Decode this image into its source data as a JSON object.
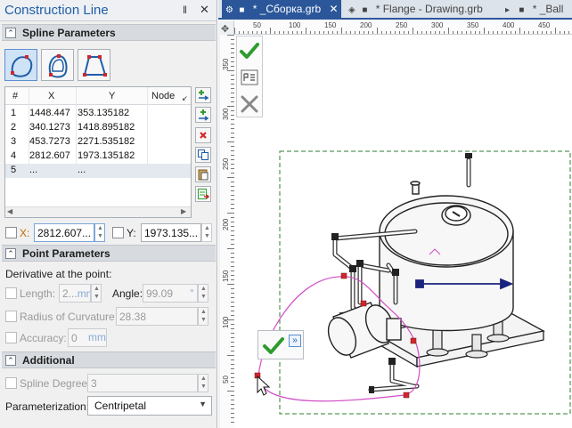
{
  "panel": {
    "title": "Construction Line",
    "pin_glyph": "‖",
    "close_glyph": "✕"
  },
  "sections": {
    "spline": "Spline Parameters",
    "point": "Point Parameters",
    "additional": "Additional"
  },
  "spline_modes": [
    {
      "name": "closed-spline-mode",
      "active": true
    },
    {
      "name": "spline-through-points-mode",
      "active": false
    },
    {
      "name": "polyline-spline-mode",
      "active": false
    }
  ],
  "table": {
    "columns": [
      "#",
      "X",
      "Y",
      "Node"
    ],
    "rows": [
      {
        "n": "1",
        "x": "1448.447",
        "y": "353.135182",
        "node": ""
      },
      {
        "n": "2",
        "x": "340.1273",
        "y": "1418.895182",
        "node": ""
      },
      {
        "n": "3",
        "x": "453.7273",
        "y": "2271.535182",
        "node": ""
      },
      {
        "n": "4",
        "x": "2812.607",
        "y": "1973.135182",
        "node": ""
      },
      {
        "n": "5",
        "x": "...",
        "y": "...",
        "node": ""
      }
    ]
  },
  "coords": {
    "x_label": "X:",
    "x_value": "2812.607...",
    "y_label": "Y:",
    "y_value": "1973.135..."
  },
  "point_params": {
    "derivative_label": "Derivative at the point:",
    "length_label": "Length:",
    "length_value": "2...",
    "length_unit": "mm",
    "angle_label": "Angle:",
    "angle_value": "99.09",
    "angle_unit": "°",
    "radius_label": "Radius of Curvature:",
    "radius_value": "28.38",
    "accuracy_label": "Accuracy:",
    "accuracy_value": "0",
    "accuracy_unit": "mm"
  },
  "additional": {
    "degree_label": "Spline Degree:",
    "degree_value": "3",
    "param_label": "Parameterization:",
    "param_value": "Centripetal"
  },
  "tabs": [
    {
      "label": "* _Сборка.grb",
      "active": true
    },
    {
      "label": "* Flange - Drawing.grb",
      "active": false
    },
    {
      "label": "* _Ball",
      "active": false
    }
  ],
  "rulers": {
    "top": [
      "50",
      "100",
      "150",
      "200",
      "250",
      "300",
      "350",
      "400",
      "450"
    ],
    "left": [
      "350",
      "300",
      "250",
      "200",
      "150",
      "100",
      "50"
    ]
  },
  "colors": {
    "accent": "#2b579a",
    "spline": "#d24cc9",
    "handle": "#d0262e",
    "axis": "#1a237e",
    "frame": "#2e7d32"
  }
}
